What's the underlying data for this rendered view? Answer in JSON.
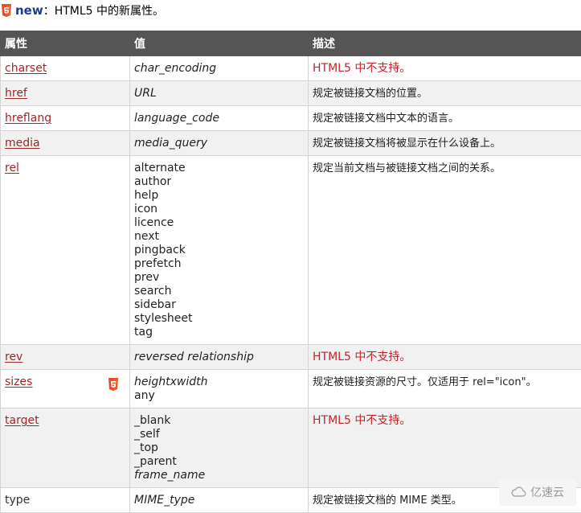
{
  "intro": {
    "keyword": "new",
    "text": "：HTML5 中的新属性。"
  },
  "table": {
    "headers": [
      "属性",
      "值",
      "描述"
    ],
    "rows": [
      {
        "attr": "charset",
        "values": [
          "char_encoding"
        ],
        "values_style": "italic",
        "desc": "HTML5 中不支持。",
        "desc_style": "red"
      },
      {
        "attr": "href",
        "values": [
          "URL"
        ],
        "values_style": "italic",
        "desc": "规定被链接文档的位置。",
        "desc_style": "normal"
      },
      {
        "attr": "hreflang",
        "values": [
          "language_code"
        ],
        "values_style": "italic",
        "desc": "规定被链接文档中文本的语言。",
        "desc_style": "normal"
      },
      {
        "attr": "media",
        "values": [
          "media_query"
        ],
        "values_style": "italic",
        "desc": "规定被链接文档将被显示在什么设备上。",
        "desc_style": "normal"
      },
      {
        "attr": "rel",
        "values": [
          "alternate",
          "author",
          "help",
          "icon",
          "licence",
          "next",
          "pingback",
          "prefetch",
          "prev",
          "search",
          "sidebar",
          "stylesheet",
          "tag"
        ],
        "values_style": "normal",
        "desc": "规定当前文档与被链接文档之间的关系。",
        "desc_style": "normal"
      },
      {
        "attr": "rev",
        "values": [
          "reversed relationship"
        ],
        "values_style": "italic",
        "desc": "HTML5 中不支持。",
        "desc_style": "red"
      },
      {
        "attr": "sizes",
        "values": [
          "heightxwidth",
          "any"
        ],
        "values_style": "mixed",
        "desc": "规定被链接资源的尺寸。仅适用于 rel=\"icon\"。",
        "desc_style": "normal",
        "html5_badge": true
      },
      {
        "attr": "target",
        "values": [
          "_blank",
          "_self",
          "_top",
          "_parent",
          "frame_name"
        ],
        "values_style": "last-italic",
        "desc": "HTML5 中不支持。",
        "desc_style": "red"
      },
      {
        "attr": "type",
        "values": [
          "MIME_type"
        ],
        "values_style": "italic",
        "desc": "规定被链接文档的 MIME 类型。",
        "desc_style": "normal",
        "plain_link": true
      }
    ]
  },
  "watermark": {
    "text": "亿速云"
  },
  "colors": {
    "header_bg": "#555555",
    "link": "#a0262a",
    "unsupported": "#c0252b",
    "keyword": "#1a3a9a",
    "badge": "#e44d26"
  }
}
